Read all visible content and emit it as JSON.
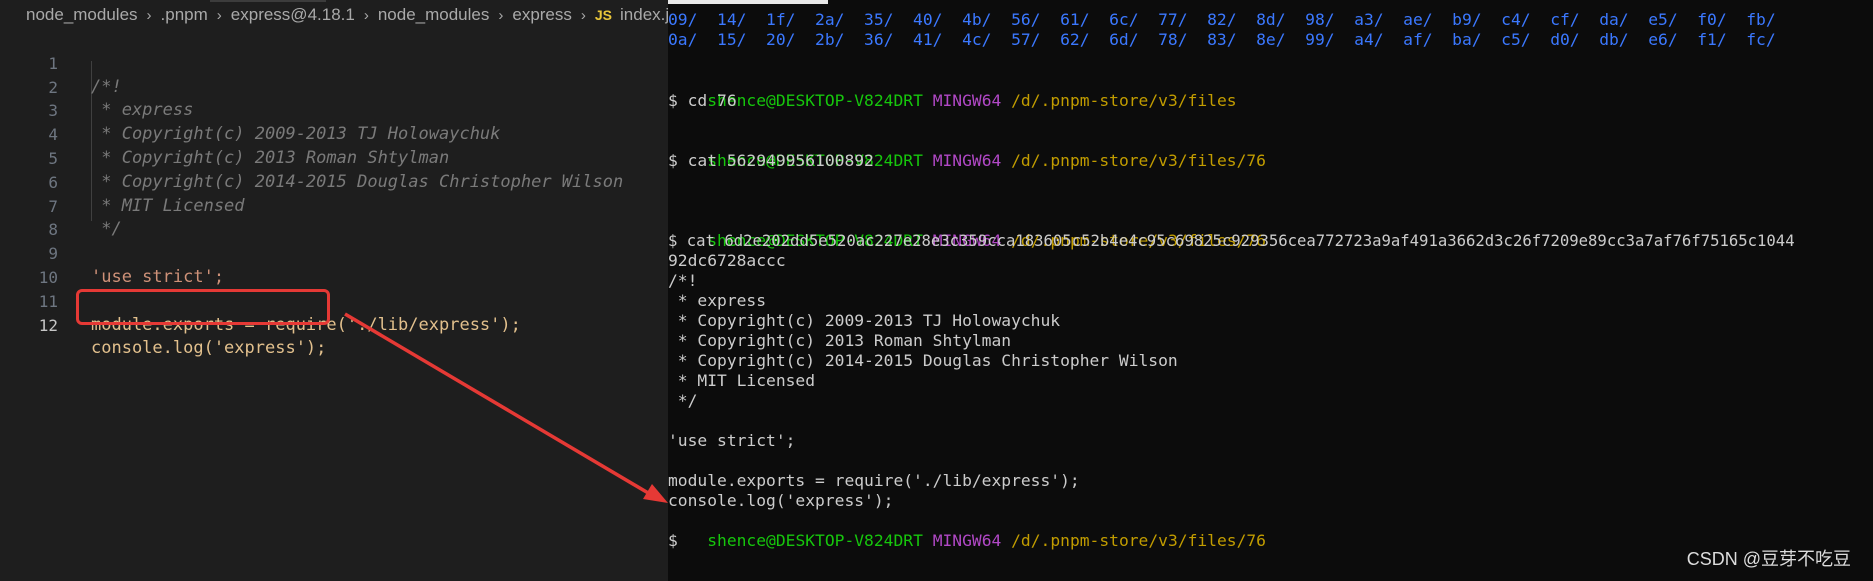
{
  "breadcrumb": {
    "items": [
      "node_modules",
      ".pnpm",
      "express@4.18.1",
      "node_modules",
      "express",
      "index.js"
    ],
    "file_type": "JS"
  },
  "editor": {
    "lines": [
      {
        "n": "1",
        "t": "/*!"
      },
      {
        "n": "2",
        "t": " * express"
      },
      {
        "n": "3",
        "t": " * Copyright(c) 2009-2013 TJ Holowaychuk"
      },
      {
        "n": "4",
        "t": " * Copyright(c) 2013 Roman Shtylman"
      },
      {
        "n": "5",
        "t": " * Copyright(c) 2014-2015 Douglas Christopher Wilson"
      },
      {
        "n": "6",
        "t": " * MIT Licensed"
      },
      {
        "n": "7",
        "t": " */"
      },
      {
        "n": "8",
        "t": ""
      },
      {
        "n": "9",
        "t": "'use strict';"
      },
      {
        "n": "10",
        "t": ""
      },
      {
        "n": "11",
        "t": "module.exports = require('./lib/express');"
      },
      {
        "n": "12",
        "t": "console.log('express');"
      }
    ]
  },
  "terminal": {
    "dirs_row1": "09/  14/  1f/  2a/  35/  40/  4b/  56/  61/  6c/  77/  82/  8d/  98/  a3/  ae/  b9/  c4/  cf/  da/  e5/  f0/  fb/",
    "dirs_row2": "0a/  15/  20/  2b/  36/  41/  4c/  57/  62/  6d/  78/  83/  8e/  99/  a4/  af/  ba/  c5/  d0/  db/  e6/  f1/  fc/",
    "user": "shence@DESKTOP-V824DRT",
    "shell": "MINGW64",
    "path1": "/d/.pnpm-store/v3/files",
    "path2": "/d/.pnpm-store/v3/files/76",
    "cmd1": "$ cd 76",
    "cmd2": "$ cat 562949956100892",
    "cmd3": "$ cat 6d2e202dd5e520ac227e28e3c359cca183605c52b4e4c95c69825c929356cea772723a9af491a3662d3c26f7209e89cc3a7af76f75165c1044",
    "cmd3_wrap": "92dc6728accc",
    "out": [
      "/*!",
      " * express",
      " * Copyright(c) 2009-2013 TJ Holowaychuk",
      " * Copyright(c) 2013 Roman Shtylman",
      " * Copyright(c) 2014-2015 Douglas Christopher Wilson",
      " * MIT Licensed",
      " */",
      "",
      "'use strict';",
      "",
      "module.exports = require('./lib/express');",
      "console.log('express');"
    ],
    "prompt_end": "$"
  },
  "watermark": "CSDN @豆芽不吃豆",
  "colors": {
    "highlight_box": "#e53935",
    "arrow": "#e53935"
  }
}
